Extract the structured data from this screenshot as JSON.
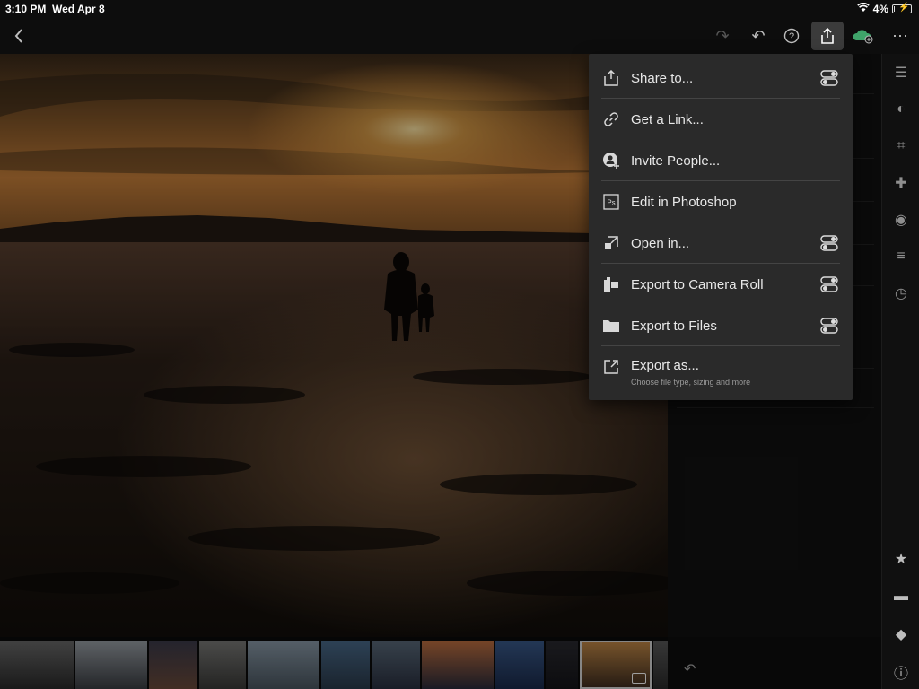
{
  "status_bar": {
    "time": "3:10 PM",
    "date": "Wed Apr 8",
    "battery": "4%",
    "battery_level": 0.04
  },
  "toolbar": {
    "back_icon": "chevron-left-icon",
    "redo_icon": "redo-icon",
    "undo_icon": "undo-icon",
    "help_icon": "help-icon",
    "share_icon": "share-icon",
    "cloud_icon": "cloud-add-icon",
    "more_icon": "more-icon"
  },
  "share_menu": {
    "items": [
      {
        "label": "Share to...",
        "icon": "share-icon",
        "has_toggle": true
      },
      {
        "label": "Get a Link...",
        "icon": "link-icon",
        "has_toggle": false
      },
      {
        "label": "Invite People...",
        "icon": "invite-people-icon",
        "has_toggle": false
      },
      {
        "label": "Edit in Photoshop",
        "icon": "photoshop-icon",
        "has_toggle": false
      },
      {
        "label": "Open in...",
        "icon": "open-in-icon",
        "has_toggle": true
      },
      {
        "label": "Export to Camera Roll",
        "icon": "camera-roll-icon",
        "has_toggle": true
      },
      {
        "label": "Export to Files",
        "icon": "folder-icon",
        "has_toggle": true
      },
      {
        "label": "Export as...",
        "icon": "export-as-icon",
        "has_toggle": false,
        "subtitle": "Choose file type, sizing and more"
      }
    ]
  },
  "right_iconbar": {
    "top_icons": [
      "sliders-icon",
      "presets-icon",
      "crop-icon",
      "healing-icon",
      "selective-icon",
      "versions-icon",
      "history-icon"
    ],
    "bottom_icons": [
      "star-icon",
      "comment-icon",
      "tag-icon",
      "info-icon"
    ]
  },
  "filmstrip": {
    "selected_index": 11,
    "thumb_count": 13
  }
}
